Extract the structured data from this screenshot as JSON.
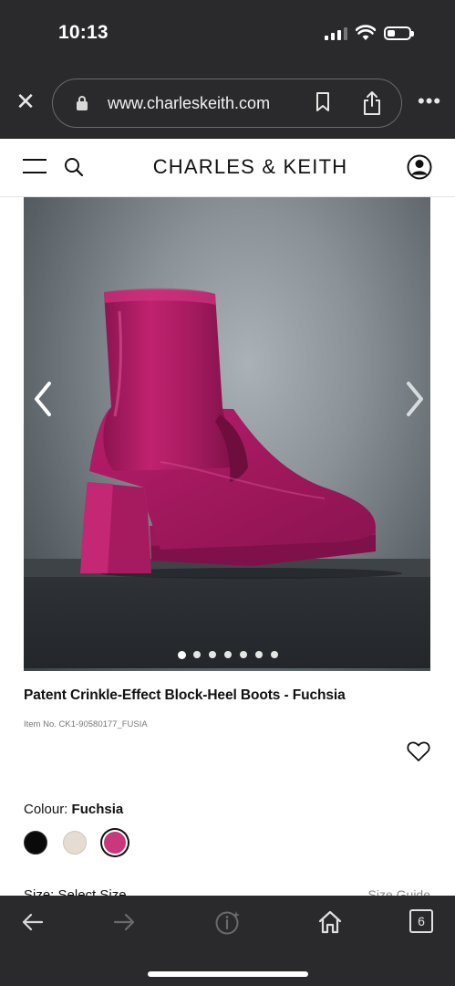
{
  "status_bar": {
    "time": "10:13"
  },
  "browser": {
    "url": "www.charleskeith.com",
    "close_icon": "close-icon",
    "tab_count": "6"
  },
  "header": {
    "brand": "CHARLES & KEITH"
  },
  "gallery": {
    "image_count": 7,
    "active_index": 0
  },
  "product": {
    "title": "Patent Crinkle-Effect Block-Heel Boots - Fuchsia",
    "item_no": "Item No. CK1-90580177_FUSIA",
    "colour_label": "Colour:",
    "colour_value": "Fuchsia",
    "swatches": [
      "#0a0a0a",
      "#e6ddd2",
      "#c8387a"
    ],
    "selected_swatch": "fuchsia",
    "size_label": "Size: Select Size",
    "size_guide": "Size Guide"
  },
  "colors": {
    "chrome_bg": "#2a2a2c",
    "boot": "#b81d6a"
  }
}
